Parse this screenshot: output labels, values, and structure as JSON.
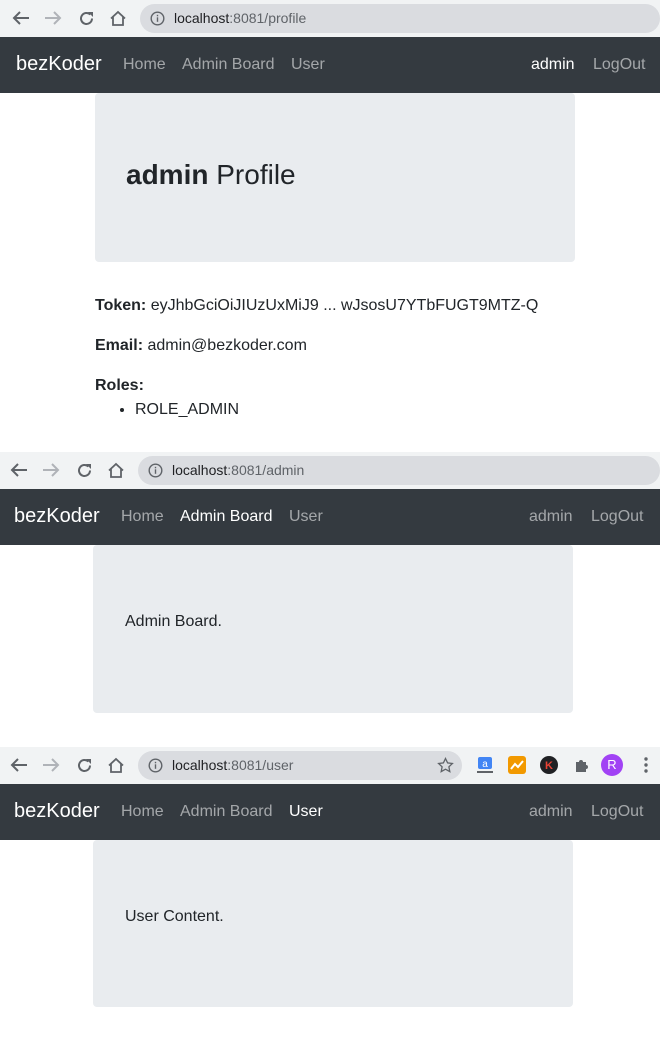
{
  "screens": [
    {
      "url_prefix": "localhost",
      "url_rest": ":8081/profile",
      "brand": "bezKoder",
      "nav": {
        "home": "Home",
        "admin_board": "Admin Board",
        "user": "User",
        "username": "admin",
        "logout": "LogOut"
      },
      "active": "username",
      "heading_user": "admin",
      "heading_rest": " Profile",
      "token_label": "Token:",
      "token_value": "eyJhbGciOiJIUzUxMiJ9 ... wJsosU7YTbFUGT9MTZ-Q",
      "email_label": "Email:",
      "email_value": "admin@bezkoder.com",
      "roles_label": "Roles:",
      "roles": [
        "ROLE_ADMIN"
      ]
    },
    {
      "url_prefix": "localhost",
      "url_rest": ":8081/admin",
      "brand": "bezKoder",
      "nav": {
        "home": "Home",
        "admin_board": "Admin Board",
        "user": "User",
        "username": "admin",
        "logout": "LogOut"
      },
      "active": "admin_board",
      "content": "Admin Board."
    },
    {
      "url_prefix": "localhost",
      "url_rest": ":8081/user",
      "brand": "bezKoder",
      "nav": {
        "home": "Home",
        "admin_board": "Admin Board",
        "user": "User",
        "username": "admin",
        "logout": "LogOut"
      },
      "active": "user",
      "content": "User Content.",
      "avatar_letter": "R",
      "extensions": [
        "translate-extension-icon",
        "analytics-extension-icon",
        "k-extension-icon",
        "extensions-puzzle-icon"
      ]
    }
  ],
  "colors": {
    "navbar": "#343a40",
    "jumbotron": "#e9ecef",
    "avatar": "#a142f4"
  }
}
